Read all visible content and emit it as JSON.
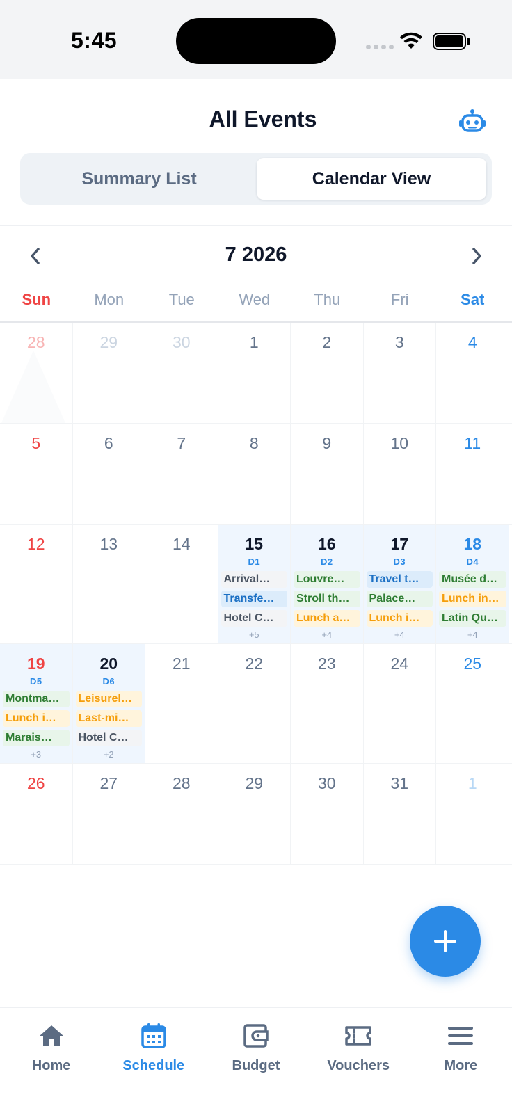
{
  "status_bar": {
    "time": "5:45"
  },
  "header": {
    "title": "All Events",
    "tabs": [
      {
        "label": "Summary List",
        "active": false
      },
      {
        "label": "Calendar View",
        "active": true
      }
    ]
  },
  "calendar": {
    "month_label": "7 2026",
    "weekdays": [
      "Sun",
      "Mon",
      "Tue",
      "Wed",
      "Thu",
      "Fri",
      "Sat"
    ],
    "weeks": [
      [
        {
          "num": "28",
          "muted": true
        },
        {
          "num": "29",
          "muted": true
        },
        {
          "num": "30",
          "muted": true
        },
        {
          "num": "1"
        },
        {
          "num": "2"
        },
        {
          "num": "3"
        },
        {
          "num": "4"
        }
      ],
      [
        {
          "num": "5"
        },
        {
          "num": "6"
        },
        {
          "num": "7"
        },
        {
          "num": "8"
        },
        {
          "num": "9"
        },
        {
          "num": "10"
        },
        {
          "num": "11"
        }
      ],
      [
        {
          "num": "12"
        },
        {
          "num": "13"
        },
        {
          "num": "14"
        },
        {
          "num": "15",
          "code": "D1",
          "events": [
            {
              "title": "Arrival…",
              "color": "gray"
            },
            {
              "title": "Transfe…",
              "color": "blue"
            },
            {
              "title": "Hotel C…",
              "color": "gray"
            }
          ],
          "more": "+5"
        },
        {
          "num": "16",
          "code": "D2",
          "events": [
            {
              "title": "Louvre…",
              "color": "green"
            },
            {
              "title": "Stroll th…",
              "color": "green"
            },
            {
              "title": "Lunch a…",
              "color": "orange"
            }
          ],
          "more": "+4"
        },
        {
          "num": "17",
          "code": "D3",
          "events": [
            {
              "title": "Travel t…",
              "color": "blue"
            },
            {
              "title": "Palace…",
              "color": "green"
            },
            {
              "title": "Lunch i…",
              "color": "orange"
            }
          ],
          "more": "+4"
        },
        {
          "num": "18",
          "code": "D4",
          "events": [
            {
              "title": "Musée d…",
              "color": "green"
            },
            {
              "title": "Lunch in…",
              "color": "orange"
            },
            {
              "title": "Latin Qu…",
              "color": "green"
            }
          ],
          "more": "+4"
        }
      ],
      [
        {
          "num": "19",
          "code": "D5",
          "events": [
            {
              "title": "Montma…",
              "color": "green"
            },
            {
              "title": "Lunch i…",
              "color": "orange"
            },
            {
              "title": "Marais…",
              "color": "green"
            }
          ],
          "more": "+3"
        },
        {
          "num": "20",
          "code": "D6",
          "events": [
            {
              "title": "Leisurel…",
              "color": "orange"
            },
            {
              "title": "Last-mi…",
              "color": "orange"
            },
            {
              "title": "Hotel C…",
              "color": "gray"
            }
          ],
          "more": "+2"
        },
        {
          "num": "21"
        },
        {
          "num": "22"
        },
        {
          "num": "23"
        },
        {
          "num": "24"
        },
        {
          "num": "25"
        }
      ],
      [
        {
          "num": "26"
        },
        {
          "num": "27"
        },
        {
          "num": "28"
        },
        {
          "num": "29"
        },
        {
          "num": "30"
        },
        {
          "num": "31"
        },
        {
          "num": "1",
          "muted": true
        }
      ]
    ]
  },
  "tabbar": {
    "items": [
      {
        "label": "Home",
        "icon": "home-icon",
        "active": false
      },
      {
        "label": "Schedule",
        "icon": "calendar-icon",
        "active": true
      },
      {
        "label": "Budget",
        "icon": "wallet-icon",
        "active": false
      },
      {
        "label": "Vouchers",
        "icon": "ticket-icon",
        "active": false
      },
      {
        "label": "More",
        "icon": "menu-icon",
        "active": false
      }
    ]
  },
  "colors": {
    "accent": "#2b8ae6",
    "sunday": "#ef4444",
    "trip_bg": "#eff6fe"
  }
}
